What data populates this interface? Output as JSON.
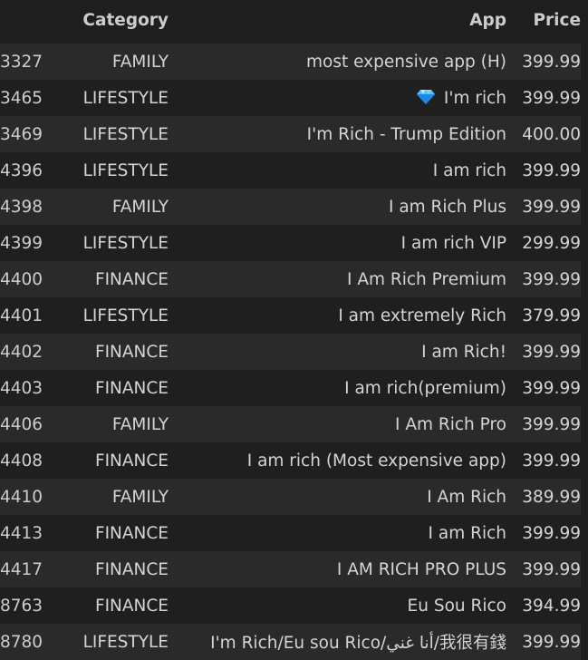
{
  "columns": {
    "index": "",
    "category": "Category",
    "app": "App",
    "price": "Price"
  },
  "rows": [
    {
      "index": "3327",
      "category": "FAMILY",
      "app": "most expensive app (H)",
      "price": "399.99"
    },
    {
      "index": "3465",
      "category": "LIFESTYLE",
      "app": "I'm rich",
      "price": "399.99",
      "icon": "gem-icon"
    },
    {
      "index": "3469",
      "category": "LIFESTYLE",
      "app": "I'm Rich - Trump Edition",
      "price": "400.00"
    },
    {
      "index": "4396",
      "category": "LIFESTYLE",
      "app": "I am rich",
      "price": "399.99"
    },
    {
      "index": "4398",
      "category": "FAMILY",
      "app": "I am Rich Plus",
      "price": "399.99"
    },
    {
      "index": "4399",
      "category": "LIFESTYLE",
      "app": "I am rich VIP",
      "price": "299.99"
    },
    {
      "index": "4400",
      "category": "FINANCE",
      "app": "I Am Rich Premium",
      "price": "399.99"
    },
    {
      "index": "4401",
      "category": "LIFESTYLE",
      "app": "I am extremely Rich",
      "price": "379.99"
    },
    {
      "index": "4402",
      "category": "FINANCE",
      "app": "I am Rich!",
      "price": "399.99"
    },
    {
      "index": "4403",
      "category": "FINANCE",
      "app": "I am rich(premium)",
      "price": "399.99"
    },
    {
      "index": "4406",
      "category": "FAMILY",
      "app": "I Am Rich Pro",
      "price": "399.99"
    },
    {
      "index": "4408",
      "category": "FINANCE",
      "app": "I am rich (Most expensive app)",
      "price": "399.99"
    },
    {
      "index": "4410",
      "category": "FAMILY",
      "app": "I Am Rich",
      "price": "389.99"
    },
    {
      "index": "4413",
      "category": "FINANCE",
      "app": "I am Rich",
      "price": "399.99"
    },
    {
      "index": "4417",
      "category": "FINANCE",
      "app": "I AM RICH PRO PLUS",
      "price": "399.99"
    },
    {
      "index": "8763",
      "category": "FINANCE",
      "app": "Eu Sou Rico",
      "price": "394.99"
    },
    {
      "index": "8780",
      "category": "LIFESTYLE",
      "app": "I'm Rich/Eu sou Rico/أنا غني/我很有錢",
      "price": "399.99"
    }
  ],
  "colors": {
    "background": "#1e1e1e",
    "row_odd": "#2a2a2a",
    "row_even": "#1f1f1f",
    "text": "#d4d4d4",
    "gem": "#4fc3f7"
  }
}
